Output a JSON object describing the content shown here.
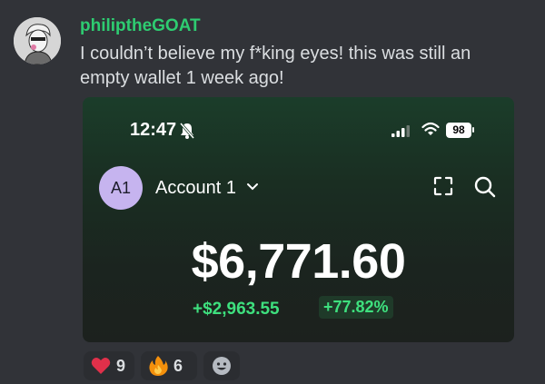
{
  "message": {
    "username": "philiptheGOAT",
    "text": "I couldn’t believe my f*king eyes! this was still an empty wallet 1 week ago!",
    "colors": {
      "username": "#2ecc71",
      "background": "#313338"
    }
  },
  "screenshot": {
    "time": "12:47",
    "battery": "98",
    "account_initials": "A1",
    "account_name": "Account 1",
    "balance": "$6,771.60",
    "change": "+$2,963.55",
    "change_pct": "+77.82%",
    "colors": {
      "positive": "#3ee07e",
      "avatar": "#c6b4ef"
    }
  },
  "reactions": [
    {
      "icon": "heart-icon",
      "count": "9"
    },
    {
      "icon": "fire-icon",
      "count": "6"
    },
    {
      "icon": "add-reaction-icon"
    }
  ]
}
